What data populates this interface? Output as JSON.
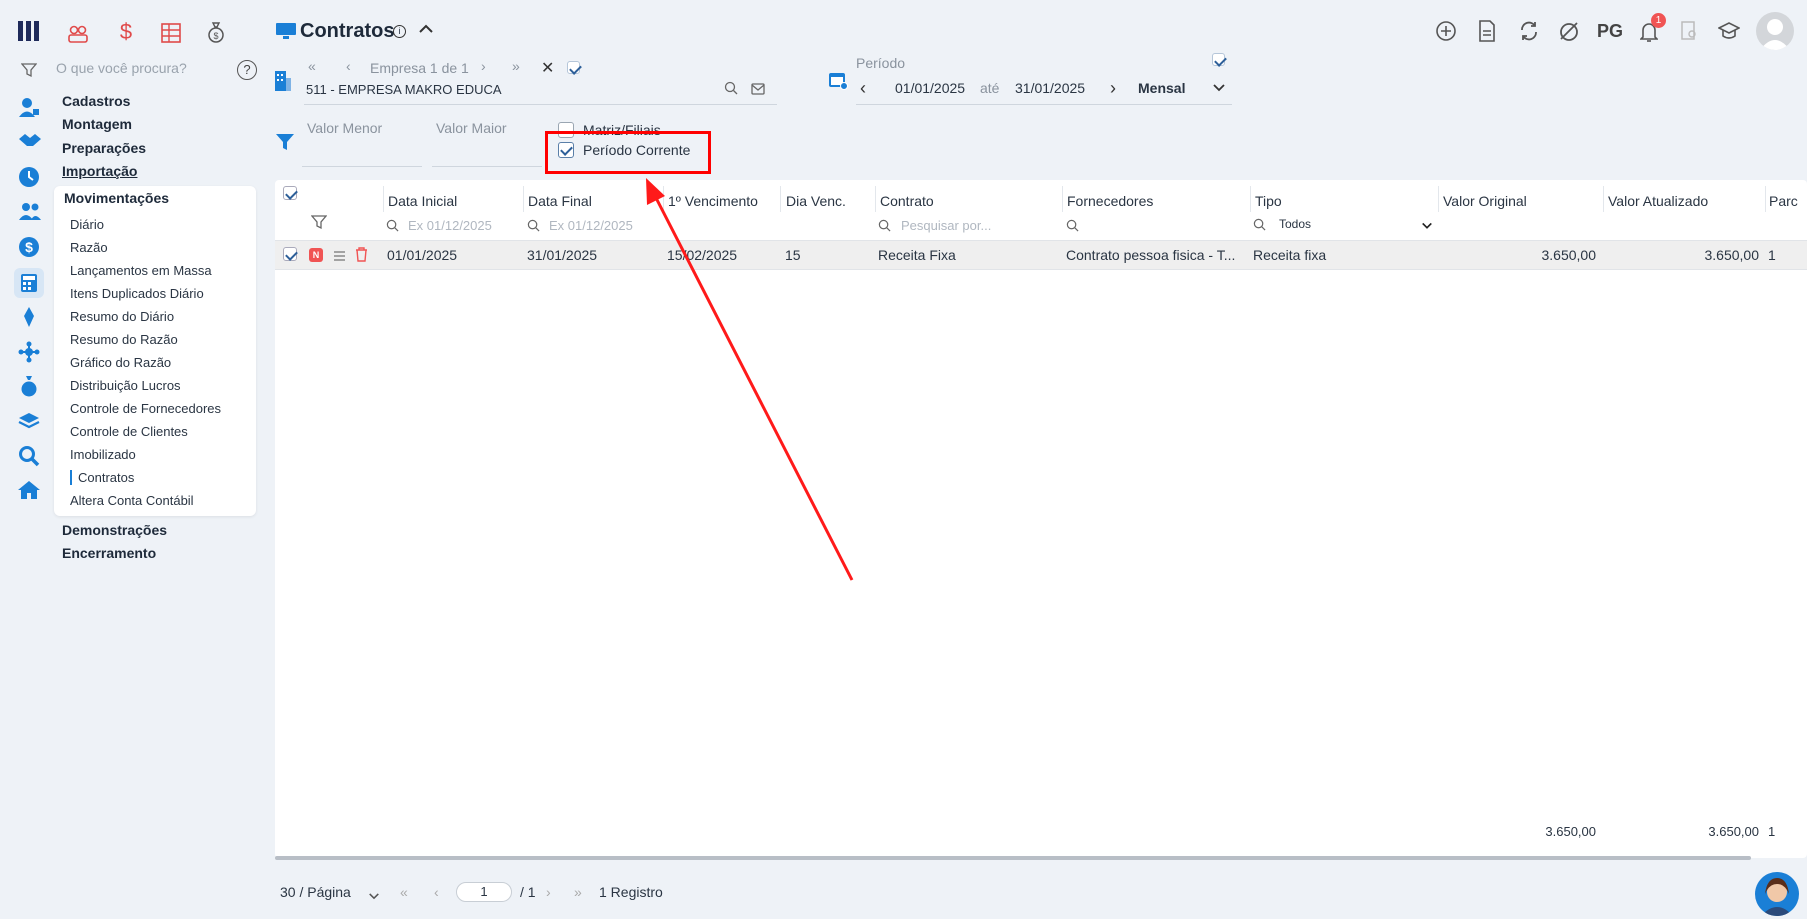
{
  "app": {
    "search_placeholder": "O que você procura?",
    "help_label": "?"
  },
  "sidebar": {
    "sections": [
      "Cadastros",
      "Montagem",
      "Preparações",
      "Importação",
      "Movimentações",
      "Demonstrações",
      "Encerramento"
    ],
    "movimentacoes_items": [
      "Diário",
      "Razão",
      "Lançamentos em Massa",
      "Itens Duplicados Diário",
      "Resumo do Diário",
      "Resumo do Razão",
      "Gráfico do Razão",
      "Distribuição Lucros",
      "Controle de Fornecedores",
      "Controle de Clientes",
      "Imobilizado",
      "Contratos",
      "Altera Conta Contábil"
    ],
    "active_item": "Contratos"
  },
  "header": {
    "title": "Contratos",
    "company_nav": "Empresa 1 de 1",
    "company_value": "511 - EMPRESA MAKRO EDUCA",
    "period_label": "Período",
    "date_start": "01/01/2025",
    "date_sep": "até",
    "date_end": "31/01/2025",
    "period_mode": "Mensal",
    "user_initials": "PG",
    "notification_count": "1"
  },
  "filters": {
    "valor_menor_label": "Valor Menor",
    "valor_maior_label": "Valor Maior",
    "matriz_label": "Matriz/Filiais",
    "periodo_corrente_label": "Período Corrente",
    "periodo_corrente_checked": true
  },
  "table": {
    "columns": [
      "Data Inicial",
      "Data Final",
      "1º Vencimento",
      "Dia Venc.",
      "Contrato",
      "Fornecedores",
      "Tipo",
      "Valor Original",
      "Valor Atualizado",
      "Parc"
    ],
    "date_placeholder": "Ex 01/12/2025",
    "contract_placeholder": "Pesquisar por...",
    "tipo_filter": "Todos",
    "rows": [
      {
        "badge": "N",
        "data_inicial": "01/01/2025",
        "data_final": "31/01/2025",
        "vencimento": "15/02/2025",
        "dia_venc": "15",
        "contrato": "Receita Fixa",
        "fornecedores": "Contrato pessoa fisica - T...",
        "tipo": "Receita fixa",
        "valor_original": "3.650,00",
        "valor_atualizado": "3.650,00",
        "parc": "1"
      }
    ],
    "totals": {
      "valor_original": "3.650,00",
      "valor_atualizado": "3.650,00",
      "parc": "1"
    }
  },
  "pagination": {
    "per_page": "30 / Página",
    "page": "1",
    "total_pages": "/ 1",
    "records": "1 Registro"
  },
  "colors": {
    "accent": "#1a7fd6",
    "highlight": "#ff0000",
    "badge": "#f05454"
  }
}
